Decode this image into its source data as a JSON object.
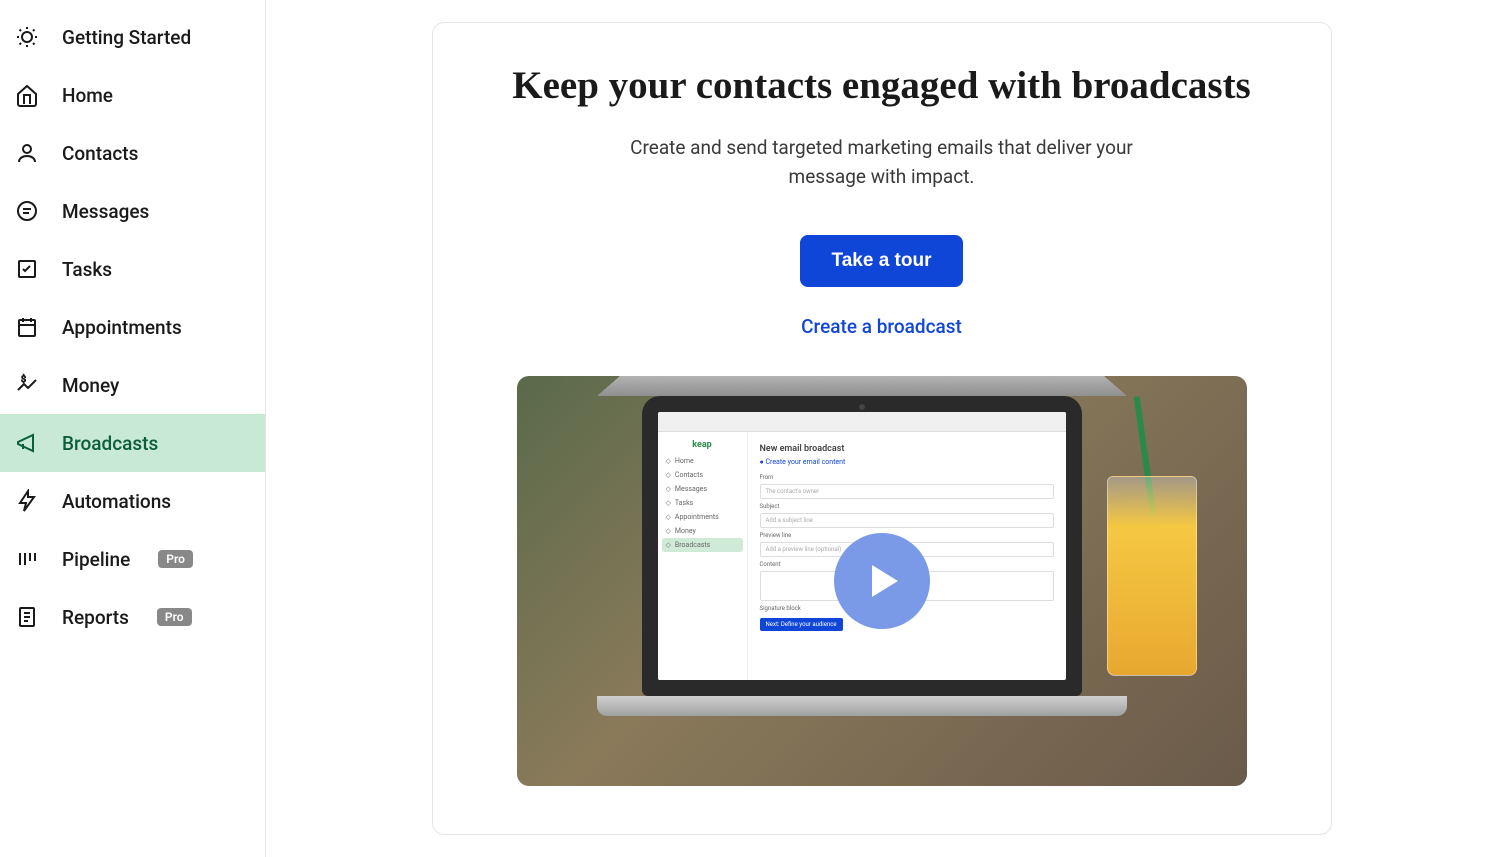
{
  "sidebar": {
    "items": [
      {
        "label": "Getting Started",
        "icon": "lightbulb-icon",
        "active": false,
        "badge": null
      },
      {
        "label": "Home",
        "icon": "home-icon",
        "active": false,
        "badge": null
      },
      {
        "label": "Contacts",
        "icon": "contacts-icon",
        "active": false,
        "badge": null
      },
      {
        "label": "Messages",
        "icon": "messages-icon",
        "active": false,
        "badge": null
      },
      {
        "label": "Tasks",
        "icon": "tasks-icon",
        "active": false,
        "badge": null
      },
      {
        "label": "Appointments",
        "icon": "calendar-icon",
        "active": false,
        "badge": null
      },
      {
        "label": "Money",
        "icon": "money-icon",
        "active": false,
        "badge": null
      },
      {
        "label": "Broadcasts",
        "icon": "broadcast-icon",
        "active": true,
        "badge": null
      },
      {
        "label": "Automations",
        "icon": "automation-icon",
        "active": false,
        "badge": null
      },
      {
        "label": "Pipeline",
        "icon": "pipeline-icon",
        "active": false,
        "badge": "Pro"
      },
      {
        "label": "Reports",
        "icon": "reports-icon",
        "active": false,
        "badge": "Pro"
      }
    ]
  },
  "main": {
    "title": "Keep your contacts engaged with broadcasts",
    "subtitle": "Create and send targeted marketing emails that deliver your message with impact.",
    "primary_button": "Take a tour",
    "secondary_link": "Create a broadcast"
  },
  "preview": {
    "brand": "keap",
    "mini_nav": [
      "Home",
      "Contacts",
      "Messages",
      "Tasks",
      "Appointments",
      "Money",
      "Broadcasts"
    ],
    "screen_title": "New email broadcast",
    "step": "Create your email content",
    "from_label": "From",
    "from_value": "The contact's owner",
    "subject_label": "Subject",
    "subject_placeholder": "Add a subject line",
    "preview_label": "Preview line",
    "preview_placeholder": "Add a preview line (optional)",
    "content_label": "Content",
    "sig_label": "Signature block",
    "next_btn": "Next: Define your audience"
  }
}
